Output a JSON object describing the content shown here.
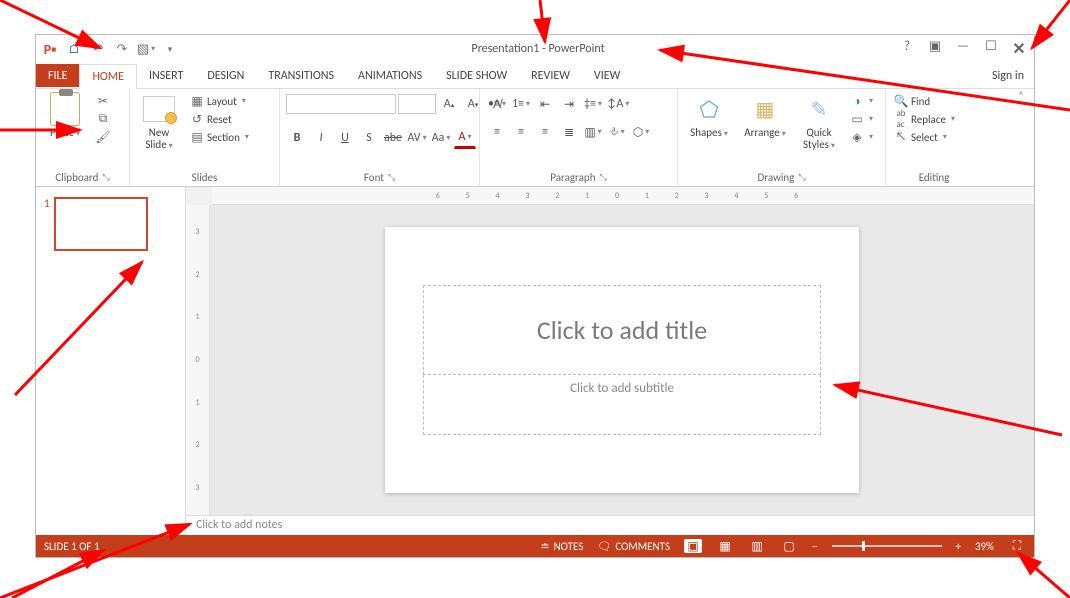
{
  "title": "Presentation1 - PowerPoint",
  "signin": "Sign in",
  "tabs": {
    "file": "FILE",
    "home": "HOME",
    "insert": "INSERT",
    "design": "DESIGN",
    "transitions": "TRANSITIONS",
    "animations": "ANIMATIONS",
    "slideshow": "SLIDE SHOW",
    "review": "REVIEW",
    "view": "VIEW"
  },
  "ribbon": {
    "clipboard": {
      "label": "Clipboard",
      "paste": "Paste"
    },
    "slides": {
      "label": "Slides",
      "newslide": "New Slide",
      "layout": "Layout",
      "reset": "Reset",
      "section": "Section"
    },
    "font": {
      "label": "Font",
      "fontname_placeholder": "",
      "size_placeholder": "",
      "bold": "B",
      "italic": "I",
      "underline": "U",
      "shadow": "S",
      "strike": "abe",
      "spacing": "AV",
      "case": "Aa",
      "fontcolor": "A"
    },
    "paragraph": {
      "label": "Paragraph"
    },
    "drawing": {
      "label": "Drawing",
      "shapes": "Shapes",
      "arrange": "Arrange",
      "quickstyles": "Quick Styles"
    },
    "editing": {
      "label": "Editing",
      "find": "Find",
      "replace": "Replace",
      "select": "Select"
    }
  },
  "slide": {
    "thumb_number": "1",
    "title_placeholder": "Click to add title",
    "subtitle_placeholder": "Click to add subtitle"
  },
  "notes_placeholder": "Click to add notes",
  "status": {
    "slidecount": "SLIDE 1 OF 1",
    "notes": "NOTES",
    "comments": "COMMENTS",
    "zoom_minus": "−",
    "zoom_plus": "+",
    "zoom_pct": "39%"
  },
  "ruler_h": "6 5 4 3 2 1 0 1 2 3 4 5 6",
  "ruler_v": [
    "3",
    "2",
    "1",
    "0",
    "1",
    "2",
    "3"
  ]
}
